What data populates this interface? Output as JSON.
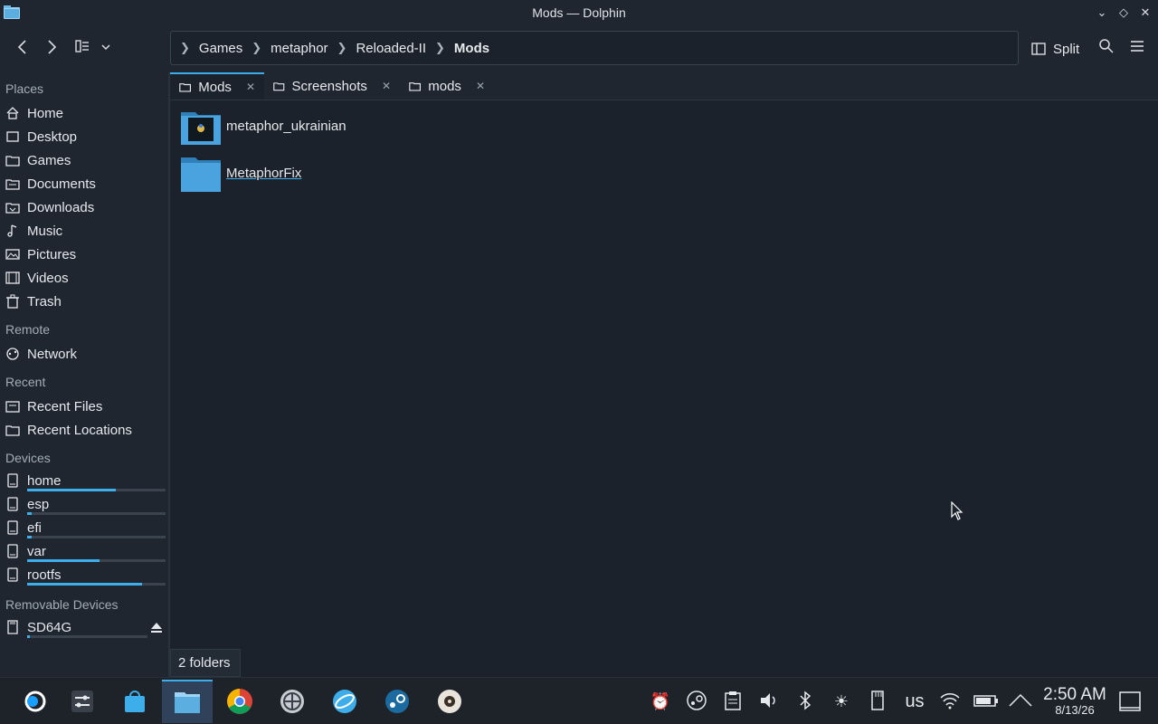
{
  "window": {
    "title": "Mods — Dolphin"
  },
  "toolbar": {
    "breadcrumb": [
      "Games",
      "metaphor",
      "Reloaded-II",
      "Mods"
    ],
    "split_label": "Split"
  },
  "sidebar": {
    "places_header": "Places",
    "places": [
      "Home",
      "Desktop",
      "Games",
      "Documents",
      "Downloads",
      "Music",
      "Pictures",
      "Videos",
      "Trash"
    ],
    "remote_header": "Remote",
    "remote": [
      "Network"
    ],
    "recent_header": "Recent",
    "recent": [
      "Recent Files",
      "Recent Locations"
    ],
    "devices_header": "Devices",
    "devices": [
      {
        "label": "home",
        "usage": 0.64
      },
      {
        "label": "esp",
        "usage": 0.03
      },
      {
        "label": "efi",
        "usage": 0.03
      },
      {
        "label": "var",
        "usage": 0.52
      },
      {
        "label": "rootfs",
        "usage": 0.83
      }
    ],
    "removable_header": "Removable Devices",
    "removable": [
      {
        "label": "SD64G",
        "usage": 0.02
      }
    ]
  },
  "tabs": [
    {
      "label": "Mods",
      "active": true
    },
    {
      "label": "Screenshots",
      "active": false
    },
    {
      "label": "mods",
      "active": false
    }
  ],
  "files": [
    {
      "name": "metaphor_ukrainian",
      "icon": "folder-with-image-icon"
    },
    {
      "name": "MetaphorFix",
      "icon": "folder-icon"
    }
  ],
  "status": {
    "text": "2 folders"
  },
  "taskbar": {
    "apps": [
      "application-launcher-icon",
      "system-settings-icon",
      "discover-store-icon",
      "dolphin-file-manager-icon",
      "chrome-browser-icon",
      "wheel-app-icon",
      "network-app-icon",
      "steam-icon",
      "media-app-icon"
    ],
    "keyboard_layout": "us",
    "time": "2:50 AM",
    "date": "8/13/26"
  },
  "colors": {
    "accent": "#3daee9",
    "background": "#1b222b",
    "panel": "#1f2630"
  }
}
